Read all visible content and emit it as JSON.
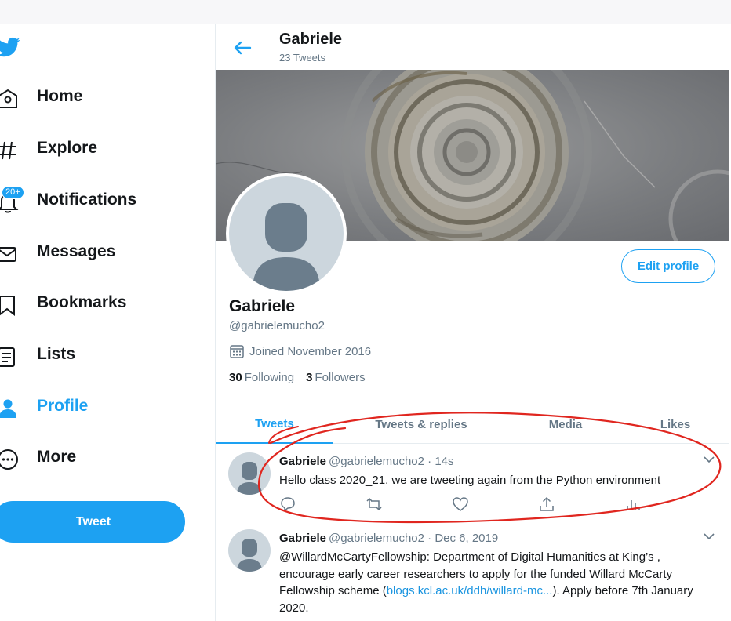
{
  "nav": {
    "items": [
      {
        "label": "Home",
        "icon": "home-icon"
      },
      {
        "label": "Explore",
        "icon": "hashtag-icon"
      },
      {
        "label": "Notifications",
        "icon": "bell-icon",
        "badge": "20+"
      },
      {
        "label": "Messages",
        "icon": "envelope-icon"
      },
      {
        "label": "Bookmarks",
        "icon": "bookmark-icon"
      },
      {
        "label": "Lists",
        "icon": "list-icon"
      },
      {
        "label": "Profile",
        "icon": "person-icon",
        "active": true
      },
      {
        "label": "More",
        "icon": "more-circle-icon"
      }
    ],
    "tweet_button": "Tweet"
  },
  "header": {
    "title": "Gabriele",
    "subtitle": "23 Tweets"
  },
  "profile": {
    "name": "Gabriele",
    "handle": "@gabrielemucho2",
    "joined": "Joined November 2016",
    "following_count": "30",
    "following_label": "Following",
    "followers_count": "3",
    "followers_label": "Followers",
    "edit_button": "Edit profile"
  },
  "tabs": [
    "Tweets",
    "Tweets & replies",
    "Media",
    "Likes"
  ],
  "tweets": [
    {
      "name": "Gabriele",
      "meta": "@gabrielemucho2 · 14s",
      "text": "Hello class 2020_21, we are tweeting again from the Python environment"
    },
    {
      "name": "Gabriele",
      "meta": "@gabrielemucho2 · Dec 6, 2019",
      "text_before": "@WillardMcCartyFellowship: Department of Digital Humanities at King’s , encourage early career researchers to apply for the funded Willard McCarty Fellowship scheme (",
      "link": "blogs.kcl.ac.uk/ddh/willard-mc...",
      "text_after": "). Apply before 7th January 2020."
    }
  ],
  "colors": {
    "accent": "#1da1f2",
    "text": "#14171a",
    "muted": "#657786",
    "annotation": "#e0261f"
  }
}
